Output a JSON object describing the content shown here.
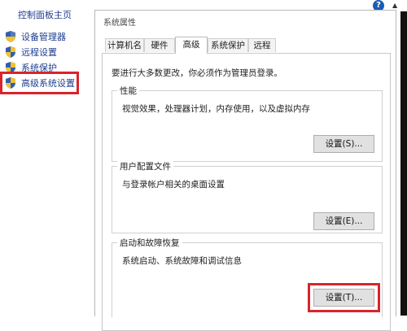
{
  "control_panel": {
    "home_label": "控制面板主页",
    "links": [
      {
        "label": "设备管理器"
      },
      {
        "label": "远程设置"
      },
      {
        "label": "系统保护"
      },
      {
        "label": "高级系统设置"
      }
    ],
    "highlight_color": "#d9242c"
  },
  "help": {
    "glyph": "?"
  },
  "scroll": {
    "glyph": "▲"
  },
  "dialog": {
    "title": "系统属性",
    "tabs": [
      {
        "label": "计算机名"
      },
      {
        "label": "硬件"
      },
      {
        "label": "高级"
      },
      {
        "label": "系统保护"
      },
      {
        "label": "远程"
      }
    ],
    "active_tab": "高级",
    "admin_note": "要进行大多数更改，你必须作为管理员登录。",
    "groups": {
      "performance": {
        "title": "性能",
        "description": "视觉效果，处理器计划，内存使用，以及虚拟内存",
        "button": "设置(S)..."
      },
      "user_profiles": {
        "title": "用户配置文件",
        "description": "与登录帐户相关的桌面设置",
        "button": "设置(E)..."
      },
      "startup_recovery": {
        "title": "启动和故障恢复",
        "description": "系统启动、系统故障和调试信息",
        "button": "设置(T)..."
      }
    }
  }
}
